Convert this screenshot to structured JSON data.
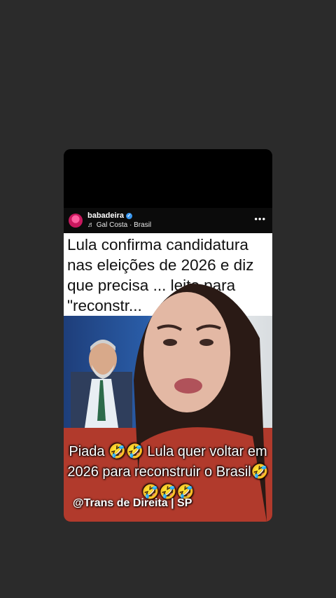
{
  "post": {
    "username": "babadeira",
    "song": "♬ Gal Costa · Brasil",
    "more_icon": "more-options-icon"
  },
  "headline": "Lula confirma candidatura nas eleições de 2026 e diz que precisa ... leito para \"reconstr...",
  "overlay": {
    "caption": "Piada 🤣🤣 Lula quer voltar em 2026 para reconstruir o Brasil🤣🤣🤣🤣",
    "credit": "@Trans de Direita | SP"
  },
  "colors": {
    "page_bg": "#2b2b2b",
    "verified": "#3897f0",
    "dress": "#b13a2c"
  }
}
